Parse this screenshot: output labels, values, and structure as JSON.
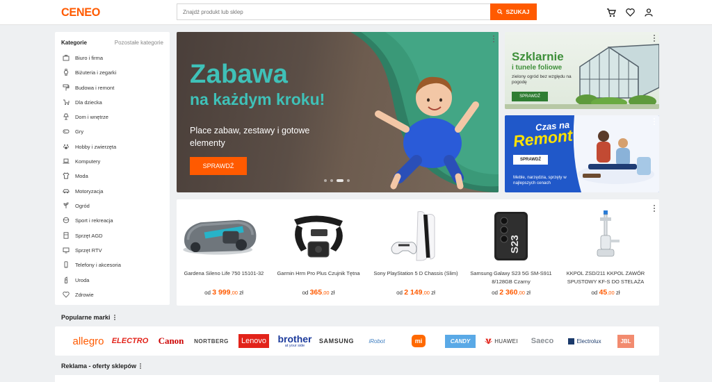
{
  "header": {
    "logo": "CENEO",
    "search_placeholder": "Znajdź produkt lub sklep",
    "search_button": "SZUKAJ"
  },
  "sidebar": {
    "title": "Kategorie",
    "other": "Pozostałe kategorie",
    "items": [
      {
        "label": "Biuro i firma",
        "icon": "briefcase-icon"
      },
      {
        "label": "Biżuteria i zegarki",
        "icon": "watch-icon"
      },
      {
        "label": "Budowa i remont",
        "icon": "paint-roller-icon"
      },
      {
        "label": "Dla dziecka",
        "icon": "stroller-icon"
      },
      {
        "label": "Dom i wnętrze",
        "icon": "lamp-icon"
      },
      {
        "label": "Gry",
        "icon": "gamepad-icon"
      },
      {
        "label": "Hobby i zwierzęta",
        "icon": "paw-icon"
      },
      {
        "label": "Komputery",
        "icon": "laptop-icon"
      },
      {
        "label": "Moda",
        "icon": "shirt-icon"
      },
      {
        "label": "Motoryzacja",
        "icon": "car-icon"
      },
      {
        "label": "Ogród",
        "icon": "plant-icon"
      },
      {
        "label": "Sport i rekreacja",
        "icon": "ball-icon"
      },
      {
        "label": "Sprzęt AGD",
        "icon": "fridge-icon"
      },
      {
        "label": "Sprzęt RTV",
        "icon": "tv-icon"
      },
      {
        "label": "Telefony i akcesoria",
        "icon": "phone-icon"
      },
      {
        "label": "Uroda",
        "icon": "lipstick-icon"
      },
      {
        "label": "Zdrowie",
        "icon": "heart-pulse-icon"
      }
    ]
  },
  "hero": {
    "title_line1": "Zabawa",
    "title_line2": "na każdym kroku!",
    "subtitle": "Place zabaw, zestawy i gotowe elementy",
    "button": "SPRAWDŹ"
  },
  "banner_garden": {
    "title": "Szklarnie",
    "subtitle": "i tunele foliowe",
    "text": "zielony ogród bez względu na pogodę",
    "button": "SPRAWDŹ"
  },
  "banner_renovation": {
    "title_small": "Czas na",
    "title_big": "Remont",
    "button": "SPRAWDŹ",
    "text": "Meble, narzędzia, sprzęty w najlepszych cenach"
  },
  "products": [
    {
      "name": "Gardena Sileno Life 750 15101-32",
      "prefix": "od",
      "price_main": "3 999",
      "price_cents": ",00",
      "currency": "zł"
    },
    {
      "name": "Garmin Hrm Pro Plus Czujnik Tętna",
      "prefix": "od",
      "price_main": "365",
      "price_cents": ",00",
      "currency": "zł"
    },
    {
      "name": "Sony PlayStation 5 D Chassis (Slim)",
      "prefix": "od",
      "price_main": "2 149",
      "price_cents": ",00",
      "currency": "zł"
    },
    {
      "name": "Samsung Galaxy S23 5G SM-S911 8/128GB Czarny",
      "prefix": "od",
      "price_main": "2 360",
      "price_cents": ",00",
      "currency": "zł"
    },
    {
      "name": "KKPOL ZSD/211 KKPOL ZAWÓR SPUSTOWY KF-S DO STELAŻA",
      "prefix": "od",
      "price_main": "45",
      "price_cents": ",00",
      "currency": "zł"
    }
  ],
  "brands_section": {
    "title": "Popularne marki",
    "brands": [
      "allegro",
      "ELECTRO",
      "Canon",
      "NORTBERG",
      "Lenovo",
      "brother",
      "SAMSUNG",
      "iRobot",
      "mi",
      "CANDY",
      "HUAWEI",
      "Saeco",
      "Electrolux",
      "JBL"
    ],
    "brother_tagline": "at your side"
  },
  "ads_section": {
    "title": "Reklama - oferty sklepów"
  },
  "colors": {
    "accent": "#ff5a00",
    "hero_teal": "#3fc1b8",
    "garden_green": "#3e8f3a",
    "renovation_blue": "#2058c9",
    "renovation_yellow": "#ffe200"
  }
}
